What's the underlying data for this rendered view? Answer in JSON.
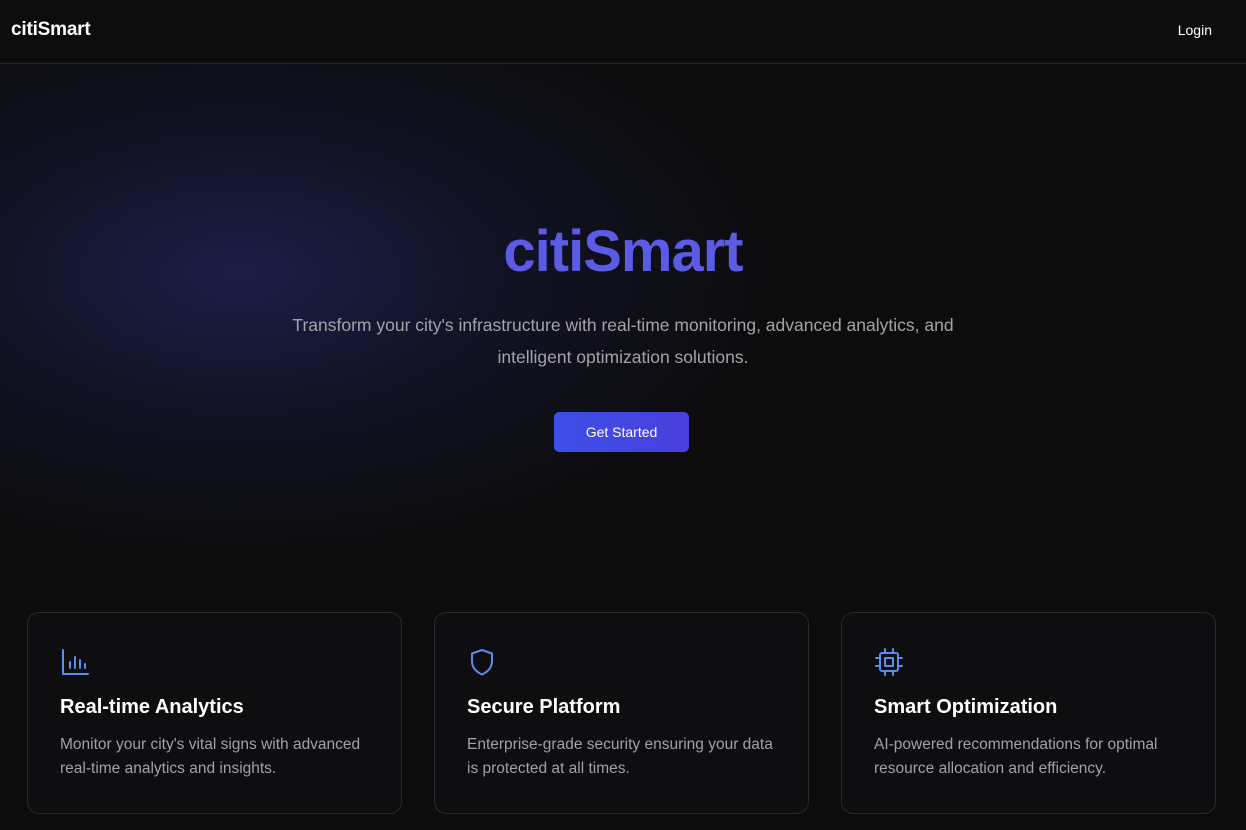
{
  "nav": {
    "brand": "citiSmart",
    "login": "Login"
  },
  "hero": {
    "title": "citiSmart",
    "subtitle": "Transform your city's infrastructure with real-time monitoring, advanced analytics, and intelligent optimization solutions.",
    "cta": "Get Started"
  },
  "features": [
    {
      "icon": "bar-chart-icon",
      "title": "Real-time Analytics",
      "description": "Monitor your city's vital signs with advanced real-time analytics and insights."
    },
    {
      "icon": "shield-icon",
      "title": "Secure Platform",
      "description": "Enterprise-grade security ensuring your data is protected at all times."
    },
    {
      "icon": "cpu-icon",
      "title": "Smart Optimization",
      "description": "AI-powered recommendations for optimal resource allocation and efficiency."
    }
  ],
  "colors": {
    "accent": "#5b5be6",
    "button": "#3b4fe6",
    "icon": "#5b8def",
    "background": "#0c0c0d"
  }
}
